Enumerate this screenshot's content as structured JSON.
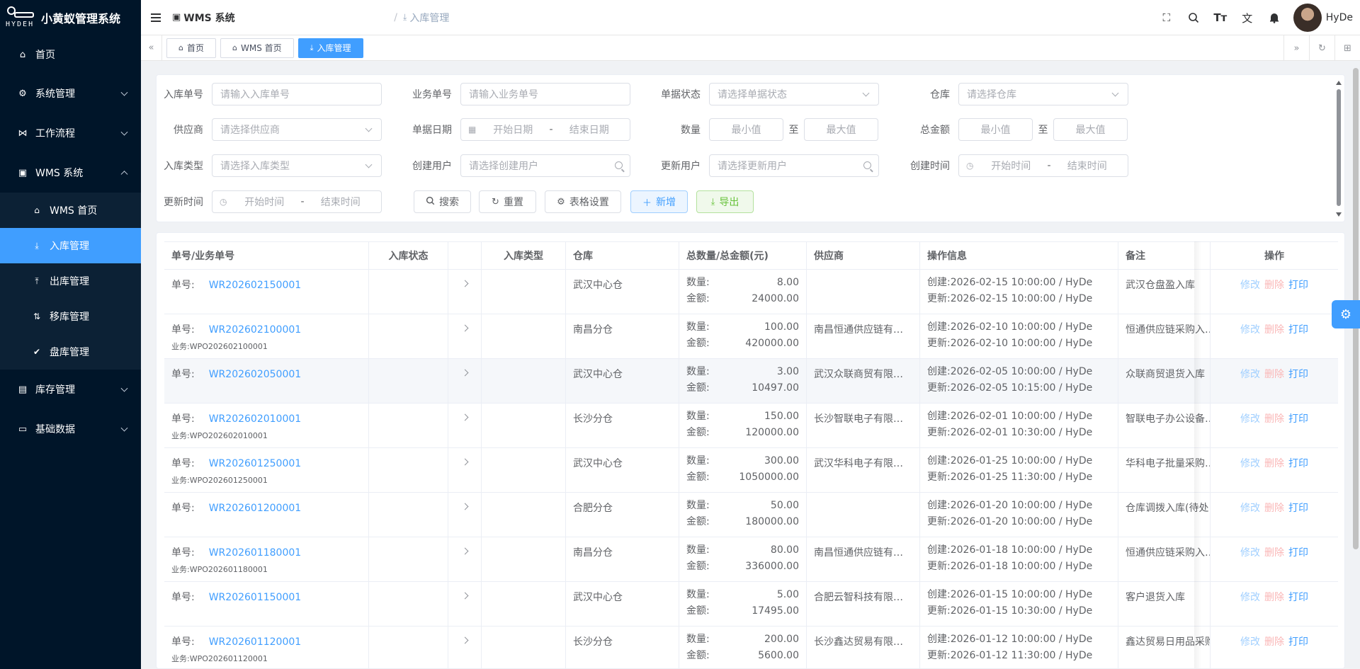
{
  "app": {
    "logo_text": "HYDEH",
    "title": "小黄蚁管理系统"
  },
  "sidebar": {
    "items": [
      {
        "label": "首页",
        "icon": "home-icon"
      },
      {
        "label": "系统管理",
        "icon": "gear-icon"
      },
      {
        "label": "工作流程",
        "icon": "workflow-icon"
      },
      {
        "label": "WMS 系统",
        "icon": "warehouse-icon"
      },
      {
        "label": "库存管理",
        "icon": "inventory-icon"
      },
      {
        "label": "基础数据",
        "icon": "database-icon"
      }
    ],
    "wms_sub": [
      {
        "label": "WMS 首页",
        "icon": "home-icon"
      },
      {
        "label": "入库管理",
        "icon": "inbound-icon"
      },
      {
        "label": "出库管理",
        "icon": "outbound-icon"
      },
      {
        "label": "移库管理",
        "icon": "transfer-icon"
      },
      {
        "label": "盘库管理",
        "icon": "check-icon"
      }
    ]
  },
  "header": {
    "crumb1": "WMS 系统",
    "crumb_sep": "/",
    "crumb2": "入库管理",
    "username": "HyDe"
  },
  "tags": [
    {
      "label": "首页"
    },
    {
      "label": "WMS 首页"
    },
    {
      "label": "入库管理"
    }
  ],
  "filters": {
    "inbound_no": {
      "label": "入库单号",
      "placeholder": "请输入入库单号"
    },
    "biz_no": {
      "label": "业务单号",
      "placeholder": "请输入业务单号"
    },
    "doc_status": {
      "label": "单据状态",
      "placeholder": "请选择单据状态"
    },
    "warehouse": {
      "label": "仓库",
      "placeholder": "请选择仓库"
    },
    "supplier": {
      "label": "供应商",
      "placeholder": "请选择供应商"
    },
    "doc_date": {
      "label": "单据日期",
      "start": "开始日期",
      "dash": "-",
      "end": "结束日期"
    },
    "quantity": {
      "label": "数量",
      "min": "最小值",
      "to": "至",
      "max": "最大值"
    },
    "total": {
      "label": "总金额",
      "min": "最小值",
      "to": "至",
      "max": "最大值"
    },
    "inbound_type": {
      "label": "入库类型",
      "placeholder": "请选择入库类型"
    },
    "create_user": {
      "label": "创建用户",
      "placeholder": "请选择创建用户"
    },
    "update_user": {
      "label": "更新用户",
      "placeholder": "请选择更新用户"
    },
    "create_time": {
      "label": "创建时间",
      "start": "开始时间",
      "dash": "-",
      "end": "结束时间"
    },
    "update_time": {
      "label": "更新时间",
      "start": "开始时间",
      "dash": "-",
      "end": "结束时间"
    }
  },
  "buttons": {
    "search": "搜索",
    "reset": "重置",
    "table_settings": "表格设置",
    "add": "新增",
    "export": "导出"
  },
  "table": {
    "columns": [
      "单号/业务单号",
      "入库状态",
      "",
      "入库类型",
      "仓库",
      "总数量/总金额(元)",
      "供应商",
      "操作信息",
      "备注",
      "操作"
    ],
    "labels": {
      "no": "单号:",
      "biz": "业务:",
      "qty": "数量:",
      "amount": "金额:",
      "created": "创建:",
      "updated": "更新:",
      "edit": "修改",
      "delete": "删除",
      "print": "打印"
    },
    "rows": [
      {
        "no": "WR202602150001",
        "biz": "",
        "warehouse": "武汉中心仓",
        "qty": "8.00",
        "amount": "24000.00",
        "supplier": "",
        "created": "2026-02-15 10:00:00 / HyDe",
        "updated": "2026-02-15 10:00:00 / HyDe",
        "remark": "武汉仓盘盈入库"
      },
      {
        "no": "WR202602100001",
        "biz": "WPO202602100001",
        "warehouse": "南昌分仓",
        "qty": "100.00",
        "amount": "420000.00",
        "supplier": "南昌恒通供应链有…",
        "created": "2026-02-10 10:00:00 / HyDe",
        "updated": "2026-02-10 10:00:00 / HyDe",
        "remark": "恒通供应链采购入…"
      },
      {
        "no": "WR202602050001",
        "biz": "",
        "warehouse": "武汉中心仓",
        "qty": "3.00",
        "amount": "10497.00",
        "supplier": "武汉众联商贸有限…",
        "created": "2026-02-05 10:00:00 / HyDe",
        "updated": "2026-02-05 10:15:00 / HyDe",
        "remark": "众联商贸退货入库"
      },
      {
        "no": "WR202602010001",
        "biz": "WPO202602010001",
        "warehouse": "长沙分仓",
        "qty": "150.00",
        "amount": "120000.00",
        "supplier": "长沙智联电子有限…",
        "created": "2026-02-01 10:00:00 / HyDe",
        "updated": "2026-02-01 10:30:00 / HyDe",
        "remark": "智联电子办公设备…"
      },
      {
        "no": "WR202601250001",
        "biz": "WPO202601250001",
        "warehouse": "武汉中心仓",
        "qty": "300.00",
        "amount": "1050000.00",
        "supplier": "武汉华科电子有限…",
        "created": "2026-01-25 10:00:00 / HyDe",
        "updated": "2026-01-25 11:30:00 / HyDe",
        "remark": "华科电子批量采购…"
      },
      {
        "no": "WR202601200001",
        "biz": "",
        "warehouse": "合肥分仓",
        "qty": "50.00",
        "amount": "180000.00",
        "supplier": "",
        "created": "2026-01-20 10:00:00 / HyDe",
        "updated": "2026-01-20 10:00:00 / HyDe",
        "remark": "仓库调拨入库(待处…"
      },
      {
        "no": "WR202601180001",
        "biz": "WPO202601180001",
        "warehouse": "南昌分仓",
        "qty": "80.00",
        "amount": "336000.00",
        "supplier": "南昌恒通供应链有…",
        "created": "2026-01-18 10:00:00 / HyDe",
        "updated": "2026-01-18 10:00:00 / HyDe",
        "remark": "恒通供应链采购入…"
      },
      {
        "no": "WR202601150001",
        "biz": "",
        "warehouse": "武汉中心仓",
        "qty": "5.00",
        "amount": "17495.00",
        "supplier": "合肥云智科技有限…",
        "created": "2026-01-15 10:00:00 / HyDe",
        "updated": "2026-01-15 10:30:00 / HyDe",
        "remark": "客户退货入库"
      },
      {
        "no": "WR202601120001",
        "biz": "WPO202601120001",
        "warehouse": "长沙分仓",
        "qty": "200.00",
        "amount": "5600.00",
        "supplier": "长沙鑫达贸易有限…",
        "created": "2026-01-12 10:00:00 / HyDe",
        "updated": "2026-01-12 11:30:00 / HyDe",
        "remark": "鑫达贸易日用品采购"
      }
    ]
  },
  "colors": {
    "sidebar_bg": "#001529",
    "accent": "#409eff",
    "danger_light": "#fab6b6",
    "success": "#67c23a"
  }
}
